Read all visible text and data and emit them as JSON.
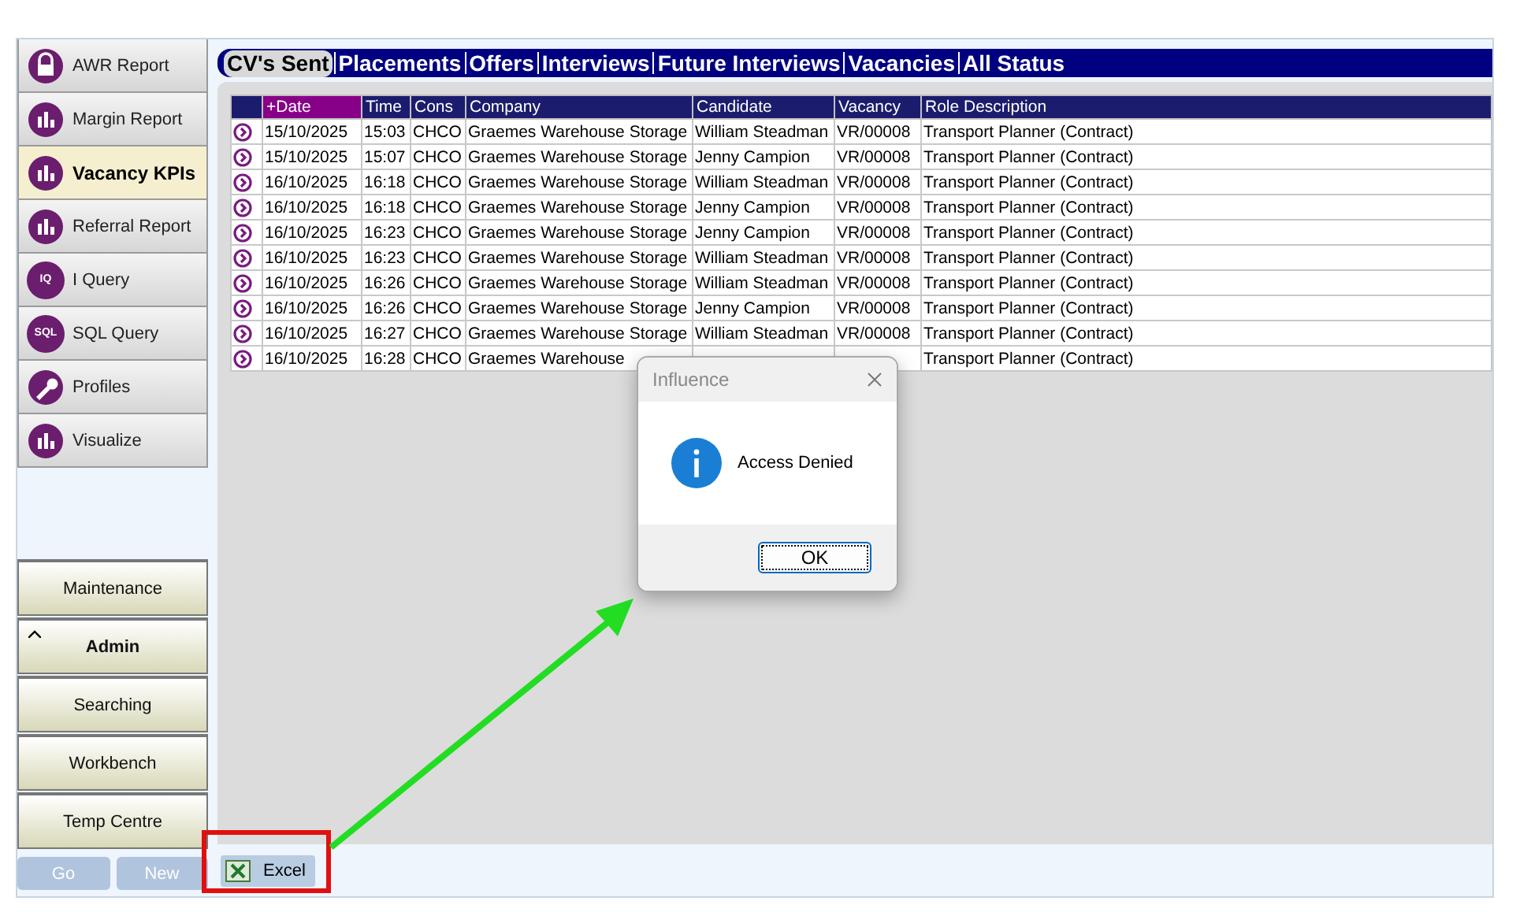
{
  "sidebar": {
    "items": [
      {
        "label": "AWR Report",
        "kind": "lock",
        "selected": false
      },
      {
        "label": "Margin Report",
        "kind": "chart",
        "selected": false
      },
      {
        "label": "Vacancy KPIs",
        "kind": "chart",
        "selected": true
      },
      {
        "label": "Referral Report",
        "kind": "chart",
        "selected": false
      },
      {
        "label": "I Query",
        "kind": "badge",
        "badge": "IQ",
        "selected": false
      },
      {
        "label": "SQL Query",
        "kind": "badge",
        "badge": "SQL",
        "selected": false
      },
      {
        "label": "Profiles",
        "kind": "wrench",
        "selected": false
      },
      {
        "label": "Visualize",
        "kind": "chart",
        "selected": false
      }
    ],
    "groups": [
      {
        "label": "Maintenance",
        "expanded": false
      },
      {
        "label": "Admin",
        "expanded": true
      },
      {
        "label": "Searching",
        "expanded": false
      },
      {
        "label": "Workbench",
        "expanded": false
      },
      {
        "label": "Temp Centre",
        "expanded": false
      }
    ],
    "buttons": [
      {
        "label": "Go",
        "disabled": true
      },
      {
        "label": "New",
        "disabled": true
      }
    ]
  },
  "tabs": [
    {
      "label": "CV's Sent",
      "selected": true
    },
    {
      "label": "Placements",
      "selected": false
    },
    {
      "label": "Offers",
      "selected": false
    },
    {
      "label": "Interviews",
      "selected": false
    },
    {
      "label": "Future Interviews",
      "selected": false
    },
    {
      "label": "Vacancies",
      "selected": false
    },
    {
      "label": "All Status",
      "selected": false
    }
  ],
  "table": {
    "columns": [
      {
        "label": "+Date",
        "sorted": true
      },
      {
        "label": "Time",
        "sorted": false
      },
      {
        "label": "Cons",
        "sorted": false
      },
      {
        "label": "Company",
        "sorted": false
      },
      {
        "label": "Candidate",
        "sorted": false
      },
      {
        "label": "Vacancy",
        "sorted": false
      },
      {
        "label": "Role Description",
        "sorted": false
      }
    ],
    "rows": [
      [
        "15/10/2025",
        "15:03",
        "CHCO",
        "Graemes Warehouse Storage",
        "William Steadman",
        "VR/00008",
        "Transport Planner (Contract)"
      ],
      [
        "15/10/2025",
        "15:07",
        "CHCO",
        "Graemes Warehouse Storage",
        "Jenny Campion",
        "VR/00008",
        "Transport Planner (Contract)"
      ],
      [
        "16/10/2025",
        "16:18",
        "CHCO",
        "Graemes Warehouse Storage",
        "William Steadman",
        "VR/00008",
        "Transport Planner (Contract)"
      ],
      [
        "16/10/2025",
        "16:18",
        "CHCO",
        "Graemes Warehouse Storage",
        "Jenny Campion",
        "VR/00008",
        "Transport Planner (Contract)"
      ],
      [
        "16/10/2025",
        "16:23",
        "CHCO",
        "Graemes Warehouse Storage",
        "Jenny Campion",
        "VR/00008",
        "Transport Planner (Contract)"
      ],
      [
        "16/10/2025",
        "16:23",
        "CHCO",
        "Graemes Warehouse Storage",
        "William Steadman",
        "VR/00008",
        "Transport Planner (Contract)"
      ],
      [
        "16/10/2025",
        "16:26",
        "CHCO",
        "Graemes Warehouse Storage",
        "William Steadman",
        "VR/00008",
        "Transport Planner (Contract)"
      ],
      [
        "16/10/2025",
        "16:26",
        "CHCO",
        "Graemes Warehouse Storage",
        "Jenny Campion",
        "VR/00008",
        "Transport Planner (Contract)"
      ],
      [
        "16/10/2025",
        "16:27",
        "CHCO",
        "Graemes Warehouse Storage",
        "William Steadman",
        "VR/00008",
        "Transport Planner (Contract)"
      ],
      [
        "16/10/2025",
        "16:28",
        "CHCO",
        "Graemes Warehouse",
        "",
        "",
        "Transport Planner (Contract)"
      ]
    ]
  },
  "export_button": {
    "label": "Excel"
  },
  "dialog": {
    "title": "Influence",
    "message": "Access Denied",
    "button": "OK"
  }
}
